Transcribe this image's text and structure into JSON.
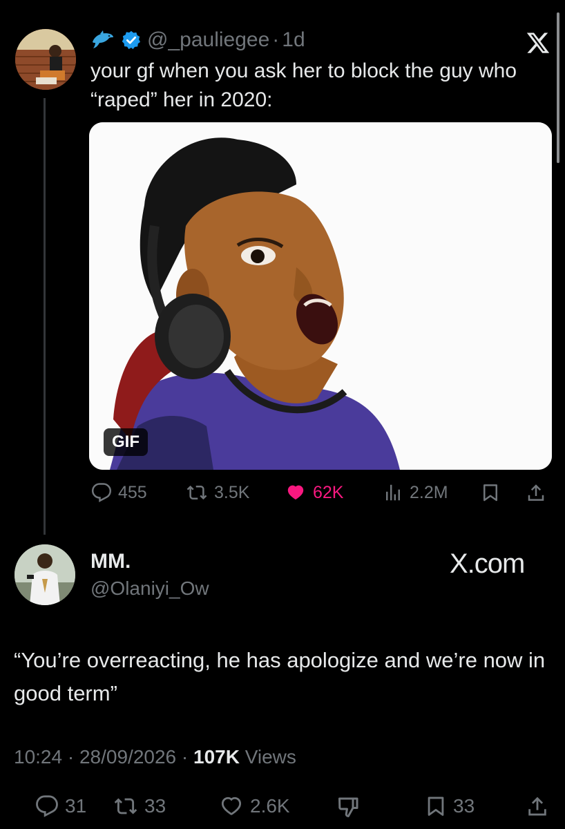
{
  "tweet": {
    "handle": "@_pauliegee",
    "time": "1d",
    "separator": "·",
    "text": "your gf when you ask her to block the guy who “raped” her in 2020:",
    "gif_label": "GIF",
    "replies": "455",
    "retweets": "3.5K",
    "likes": "62K",
    "views": "2.2M",
    "icons": [
      "dolphin-emoji",
      "verified-badge",
      "x-logo",
      "reply",
      "retweet",
      "heart-filled",
      "views-bars",
      "bookmark",
      "share"
    ]
  },
  "reply": {
    "name": "MM.",
    "handle": "@Olaniyi_Ow",
    "watermark": "X.com",
    "text": "“You’re overreacting, he has apologize and we’re now in good term”",
    "time": "10:24",
    "date": "28/09/2026",
    "views_count": "107K",
    "views_label": "Views",
    "replies": "31",
    "retweets": "33",
    "likes": "2.6K",
    "bookmarks": "33"
  },
  "colors": {
    "background": "#000000",
    "text": "#e7e9ea",
    "muted": "#71767b",
    "like": "#f91880",
    "verified": "#1d9bf0"
  }
}
